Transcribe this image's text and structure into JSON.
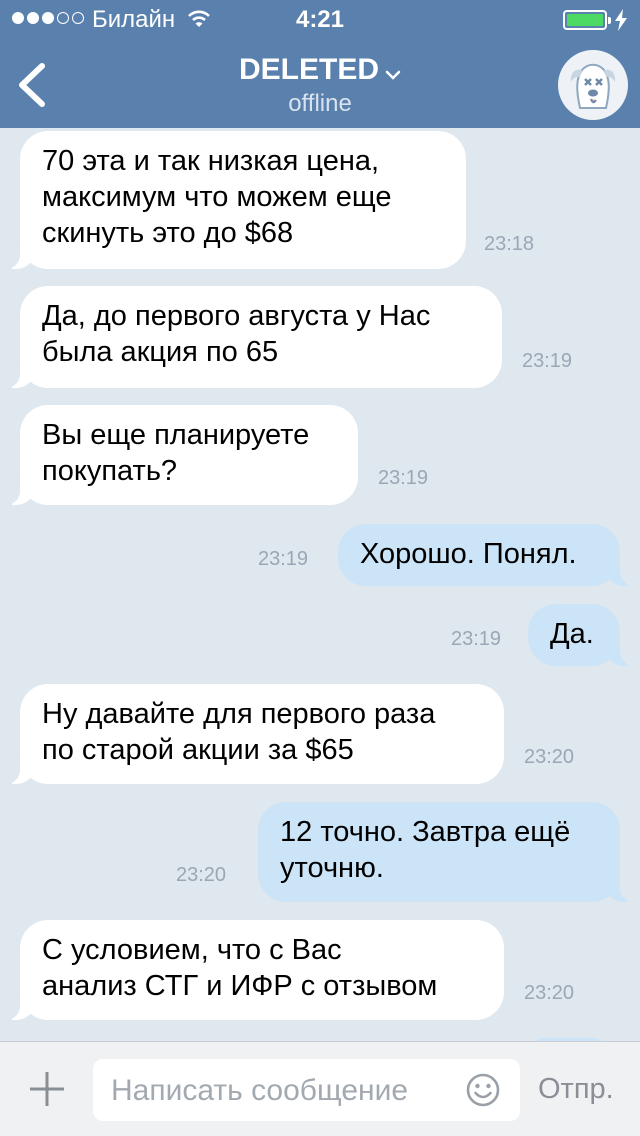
{
  "status_bar": {
    "carrier": "Билайн",
    "time": "4:21"
  },
  "header": {
    "title": "DELETED",
    "subtitle": "offline",
    "back_icon": "chevron-left-icon",
    "avatar_icon": "deleted-dog-avatar-icon"
  },
  "messages": [
    {
      "direction": "in",
      "text": "70 эта и так низкая цена,\nмаксимум что можем еще\nскинуть это до $68",
      "time": "23:18"
    },
    {
      "direction": "in",
      "text": "Да, до первого августа у Нас\nбыла акция по 65",
      "time": "23:19"
    },
    {
      "direction": "in",
      "text": "Вы еще планируете\nпокупать?",
      "time": "23:19"
    },
    {
      "direction": "out",
      "text": "Хорошо. Понял.",
      "time": "23:19"
    },
    {
      "direction": "out",
      "text": "Да.",
      "time": "23:19"
    },
    {
      "direction": "in",
      "text": "Ну давайте для первого раза\nпо старой акции за $65",
      "time": "23:20"
    },
    {
      "direction": "out",
      "text": "12 точно. Завтра ещё\nуточню.",
      "time": "23:20"
    },
    {
      "direction": "in",
      "text": "С условием, что с Вас\nанализ СТГ и ИФР с отзывом",
      "time": "23:20"
    }
  ],
  "composer": {
    "placeholder": "Написать сообщение",
    "send_label": "Отпр.",
    "attach_icon": "plus-icon",
    "emoji_icon": "smile-icon"
  },
  "colors": {
    "header_bg": "#5a81ad",
    "chat_bg": "#dfe7ef",
    "incoming_bubble": "#ffffff",
    "outgoing_bubble": "#cce4f7",
    "battery": "#4cd964"
  }
}
